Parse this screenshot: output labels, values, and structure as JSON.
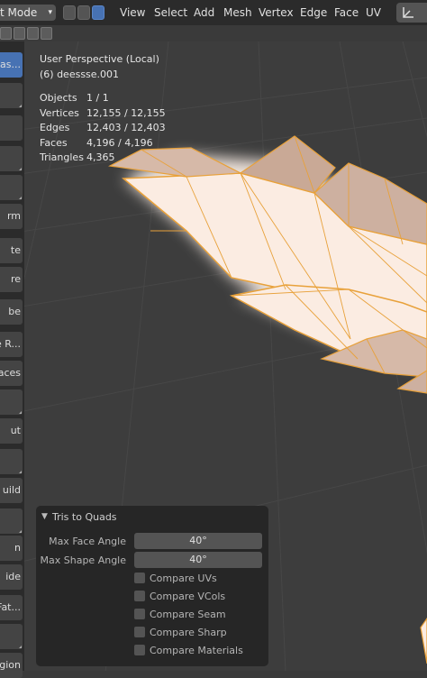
{
  "header": {
    "mode_label": "t Mode",
    "menu": [
      "View",
      "Select",
      "Add",
      "Mesh",
      "Vertex",
      "Edge",
      "Face",
      "UV"
    ]
  },
  "sidebar_tabs": [
    {
      "label": "Las..."
    },
    {
      "label": ""
    },
    {
      "label": ""
    },
    {
      "label": ""
    },
    {
      "label": ""
    },
    {
      "label": "rm"
    },
    {
      "label": "te"
    },
    {
      "label": "re"
    },
    {
      "label": "be"
    },
    {
      "label": "e R..."
    },
    {
      "label": "aces"
    },
    {
      "label": ""
    },
    {
      "label": "ut"
    },
    {
      "label": ""
    },
    {
      "label": "uild"
    },
    {
      "label": ""
    },
    {
      "label": "n"
    },
    {
      "label": "ide"
    },
    {
      "label": "Fat..."
    },
    {
      "label": ""
    },
    {
      "label": "egion"
    }
  ],
  "viewport_info": {
    "perspective": "User Perspective (Local)",
    "object_name": "(6) deessse.001",
    "stats": [
      {
        "key": "Objects",
        "value": "1 / 1"
      },
      {
        "key": "Vertices",
        "value": "12,155 / 12,155"
      },
      {
        "key": "Edges",
        "value": "12,403 / 12,403"
      },
      {
        "key": "Faces",
        "value": "4,196 / 4,196"
      },
      {
        "key": "Triangles",
        "value": "4,365"
      }
    ]
  },
  "redo_panel": {
    "title": "Tris to Quads",
    "max_face_angle_label": "Max Face Angle",
    "max_face_angle_value": "40°",
    "max_shape_angle_label": "Max Shape Angle",
    "max_shape_angle_value": "40°",
    "checkboxes": [
      {
        "label": "Compare UVs",
        "checked": false
      },
      {
        "label": "Compare VCols",
        "checked": false
      },
      {
        "label": "Compare Seam",
        "checked": false
      },
      {
        "label": "Compare Sharp",
        "checked": false
      },
      {
        "label": "Compare Materials",
        "checked": false
      }
    ]
  },
  "colors": {
    "selection_outline": "#e8a13a",
    "face_fill": "#fbece2",
    "accent": "#4772b3"
  }
}
